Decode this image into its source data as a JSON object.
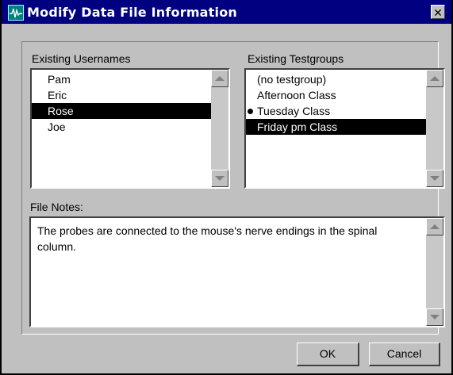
{
  "window": {
    "title": "Modify Data File Information",
    "close_label": "✕"
  },
  "usernames": {
    "label": "Existing Usernames",
    "items": [
      {
        "label": "Pam",
        "selected": false
      },
      {
        "label": "Eric",
        "selected": false
      },
      {
        "label": "Rose",
        "selected": true
      },
      {
        "label": "Joe",
        "selected": false
      }
    ]
  },
  "testgroups": {
    "label": "Existing Testgroups",
    "items": [
      {
        "label": "(no testgroup)",
        "selected": false,
        "marked": false
      },
      {
        "label": "Afternoon Class",
        "selected": false,
        "marked": false
      },
      {
        "label": "Tuesday Class",
        "selected": false,
        "marked": true
      },
      {
        "label": "Friday pm Class",
        "selected": true,
        "marked": false
      }
    ]
  },
  "notes": {
    "label": "File Notes:",
    "value": "The probes are connected to the mouse's nerve endings in the spinal column."
  },
  "buttons": {
    "ok": "OK",
    "cancel": "Cancel"
  },
  "colors": {
    "titlebar": "#000080",
    "face": "#c0c0c0",
    "selection": "#000000"
  }
}
